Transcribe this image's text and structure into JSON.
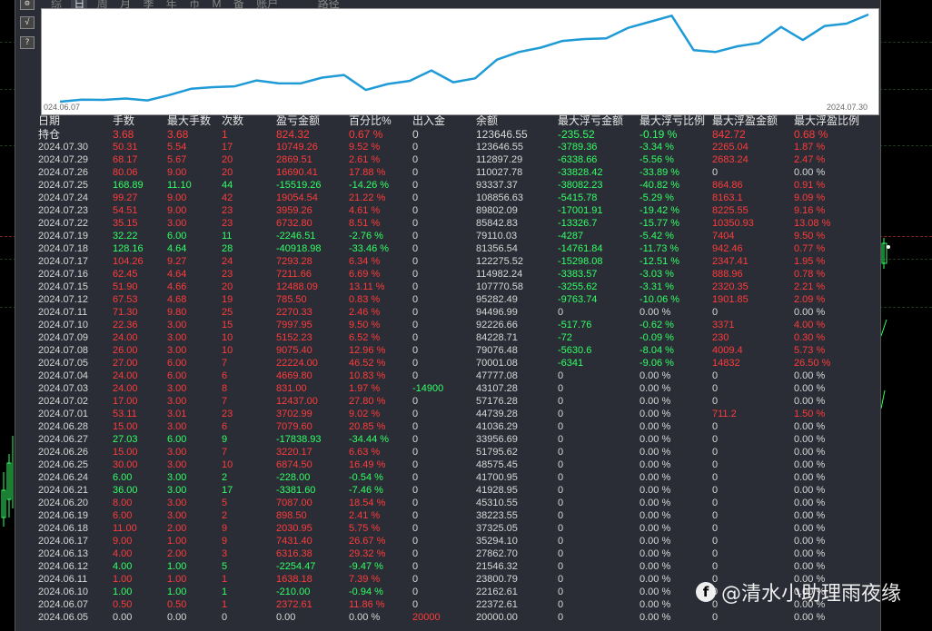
{
  "toolbar": {
    "icons": [
      "settings-icon",
      "check-icon",
      "help-icon"
    ],
    "icon_glyphs": [
      "⚙",
      "√",
      "?"
    ],
    "tabs": [
      "综",
      "日",
      "周",
      "月",
      "季",
      "年",
      "币",
      "M",
      "备",
      "账户"
    ],
    "active_tab": "日",
    "path_label": "路径"
  },
  "chart": {
    "start_label": "024.06.07",
    "end_label": "2024.07.30"
  },
  "chart_data": {
    "type": "line",
    "x": [
      "2024.06.05",
      "2024.06.07",
      "2024.06.10",
      "2024.06.11",
      "2024.06.12",
      "2024.06.13",
      "2024.06.17",
      "2024.06.18",
      "2024.06.19",
      "2024.06.20",
      "2024.06.21",
      "2024.06.24",
      "2024.06.25",
      "2024.06.26",
      "2024.06.27",
      "2024.06.28",
      "2024.07.01",
      "2024.07.02",
      "2024.07.03",
      "2024.07.04",
      "2024.07.05",
      "2024.07.08",
      "2024.07.09",
      "2024.07.10",
      "2024.07.11",
      "2024.07.12",
      "2024.07.15",
      "2024.07.16",
      "2024.07.17",
      "2024.07.18",
      "2024.07.19",
      "2024.07.22",
      "2024.07.23",
      "2024.07.24",
      "2024.07.25",
      "2024.07.26",
      "2024.07.29",
      "2024.07.30"
    ],
    "series": [
      {
        "values": [
          20000.0,
          22372.61,
          22162.61,
          23800.79,
          21546.32,
          27862.7,
          35294.1,
          37325.05,
          38223.55,
          45310.55,
          41928.95,
          41700.95,
          48575.45,
          51795.62,
          33956.69,
          41036.29,
          44739.28,
          57176.28,
          43107.28,
          47777.08,
          70001.08,
          79076.48,
          84228.71,
          92226.66,
          94496.99,
          95282.49,
          107770.58,
          114982.24,
          122275.52,
          81356.54,
          79110.03,
          85842.83,
          89802.09,
          108856.63,
          93337.37,
          110027.78,
          112897.29,
          123646.55
        ]
      }
    ]
  },
  "table": {
    "headers": [
      "日期",
      "手数",
      "最大手数",
      "次数",
      "盈亏金额",
      "百分比%",
      "出入金",
      "余额",
      "最大浮亏金额",
      "最大浮亏比例",
      "最大浮盈金额",
      "最大浮盈比例"
    ],
    "hold": [
      "持仓",
      "3.68",
      "3.68",
      "1",
      "824.32",
      "0.67 %",
      "0",
      "123646.55",
      "-235.52",
      "-0.19 %",
      "842.72",
      "0.68 %"
    ],
    "rows": [
      [
        "2024.07.30",
        "50.31",
        "5.54",
        "17",
        "10749.26",
        "9.52 %",
        "0",
        "123646.55",
        "-3789.36",
        "-3.34 %",
        "2265.04",
        "1.87 %"
      ],
      [
        "2024.07.29",
        "68.17",
        "5.67",
        "20",
        "2869.51",
        "2.61 %",
        "0",
        "112897.29",
        "-6338.66",
        "-5.56 %",
        "2683.24",
        "2.47 %"
      ],
      [
        "2024.07.26",
        "80.06",
        "9.00",
        "20",
        "16690.41",
        "17.88 %",
        "0",
        "110027.78",
        "-33828.42",
        "-33.89 %",
        "0",
        "0.00 %"
      ],
      [
        "2024.07.25",
        "168.89",
        "11.10",
        "44",
        "-15519.26",
        "-14.26 %",
        "0",
        "93337.37",
        "-38082.23",
        "-40.82 %",
        "864.86",
        "0.91 %"
      ],
      [
        "2024.07.24",
        "99.27",
        "9.00",
        "42",
        "19054.54",
        "21.22 %",
        "0",
        "108856.63",
        "-5415.78",
        "-5.29 %",
        "8163.1",
        "9.09 %"
      ],
      [
        "2024.07.23",
        "54.51",
        "9.00",
        "23",
        "3959.26",
        "4.61 %",
        "0",
        "89802.09",
        "-17001.91",
        "-19.42 %",
        "8225.55",
        "9.16 %"
      ],
      [
        "2024.07.22",
        "35.15",
        "3.00",
        "23",
        "6732.80",
        "8.51 %",
        "0",
        "85842.83",
        "-13326.7",
        "-15.77 %",
        "10350.93",
        "13.08 %"
      ],
      [
        "2024.07.19",
        "32.22",
        "6.00",
        "11",
        "-2246.51",
        "-2.76 %",
        "0",
        "79110.03",
        "-4287",
        "-5.42 %",
        "7404",
        "9.50 %"
      ],
      [
        "2024.07.18",
        "128.16",
        "4.64",
        "28",
        "-40918.98",
        "-33.46 %",
        "0",
        "81356.54",
        "-14761.84",
        "-11.73 %",
        "942.46",
        "0.77 %"
      ],
      [
        "2024.07.17",
        "104.26",
        "9.27",
        "24",
        "7293.28",
        "6.34 %",
        "0",
        "122275.52",
        "-15298.08",
        "-12.51 %",
        "2347.41",
        "1.95 %"
      ],
      [
        "2024.07.16",
        "62.45",
        "4.64",
        "23",
        "7211.66",
        "6.69 %",
        "0",
        "114982.24",
        "-3383.57",
        "-3.03 %",
        "888.96",
        "0.78 %"
      ],
      [
        "2024.07.15",
        "51.90",
        "4.66",
        "20",
        "12488.09",
        "13.11 %",
        "0",
        "107770.58",
        "-3255.62",
        "-3.31 %",
        "2320.35",
        "2.21 %"
      ],
      [
        "2024.07.12",
        "67.53",
        "4.68",
        "19",
        "785.50",
        "0.83 %",
        "0",
        "95282.49",
        "-9763.74",
        "-10.06 %",
        "1901.85",
        "2.09 %"
      ],
      [
        "2024.07.11",
        "71.30",
        "9.80",
        "25",
        "2270.33",
        "2.46 %",
        "0",
        "94496.99",
        "0",
        "0.00 %",
        "0",
        "0.00 %"
      ],
      [
        "2024.07.10",
        "22.36",
        "3.00",
        "15",
        "7997.95",
        "9.50 %",
        "0",
        "92226.66",
        "-517.76",
        "-0.62 %",
        "3371",
        "4.00 %"
      ],
      [
        "2024.07.09",
        "24.00",
        "3.00",
        "10",
        "5152.23",
        "6.52 %",
        "0",
        "84228.71",
        "-72",
        "-0.09 %",
        "230",
        "0.30 %"
      ],
      [
        "2024.07.08",
        "26.00",
        "3.00",
        "10",
        "9075.40",
        "12.96 %",
        "0",
        "79076.48",
        "-5630.6",
        "-8.04 %",
        "4009.4",
        "5.73 %"
      ],
      [
        "2024.07.05",
        "27.00",
        "6.00",
        "7",
        "22224.00",
        "46.52 %",
        "0",
        "70001.08",
        "-6341",
        "-9.06 %",
        "14832",
        "26.50 %"
      ],
      [
        "2024.07.04",
        "24.00",
        "6.00",
        "6",
        "4669.80",
        "10.83 %",
        "0",
        "47777.08",
        "0",
        "0.00 %",
        "0",
        "0.00 %"
      ],
      [
        "2024.07.03",
        "24.00",
        "3.00",
        "8",
        "831.00",
        "1.97 %",
        "-14900",
        "43107.28",
        "0",
        "0.00 %",
        "0",
        "0.00 %"
      ],
      [
        "2024.07.02",
        "17.00",
        "3.00",
        "7",
        "12437.00",
        "27.80 %",
        "0",
        "57176.28",
        "0",
        "0.00 %",
        "0",
        "0.00 %"
      ],
      [
        "2024.07.01",
        "53.11",
        "3.01",
        "23",
        "3702.99",
        "9.02 %",
        "0",
        "44739.28",
        "0",
        "0.00 %",
        "711.2",
        "1.50 %"
      ],
      [
        "2024.06.28",
        "15.00",
        "3.00",
        "6",
        "7079.60",
        "20.85 %",
        "0",
        "41036.29",
        "0",
        "0.00 %",
        "0",
        "0.00 %"
      ],
      [
        "2024.06.27",
        "27.03",
        "6.00",
        "9",
        "-17838.93",
        "-34.44 %",
        "0",
        "33956.69",
        "0",
        "0.00 %",
        "0",
        "0.00 %"
      ],
      [
        "2024.06.26",
        "15.00",
        "3.00",
        "7",
        "3220.17",
        "6.63 %",
        "0",
        "51795.62",
        "0",
        "0.00 %",
        "0",
        "0.00 %"
      ],
      [
        "2024.06.25",
        "30.00",
        "3.00",
        "10",
        "6874.50",
        "16.49 %",
        "0",
        "48575.45",
        "0",
        "0.00 %",
        "0",
        "0.00 %"
      ],
      [
        "2024.06.24",
        "6.00",
        "3.00",
        "2",
        "-228.00",
        "-0.54 %",
        "0",
        "41700.95",
        "0",
        "0.00 %",
        "0",
        "0.00 %"
      ],
      [
        "2024.06.21",
        "36.00",
        "3.00",
        "17",
        "-3381.60",
        "-7.46 %",
        "0",
        "41928.95",
        "0",
        "0.00 %",
        "0",
        "0.00 %"
      ],
      [
        "2024.06.20",
        "8.00",
        "3.00",
        "5",
        "7087.00",
        "18.54 %",
        "0",
        "45310.55",
        "0",
        "0.00 %",
        "0",
        "0.00 %"
      ],
      [
        "2024.06.19",
        "6.00",
        "3.00",
        "2",
        "898.50",
        "2.41 %",
        "0",
        "38223.55",
        "0",
        "0.00 %",
        "0",
        "0.00 %"
      ],
      [
        "2024.06.18",
        "11.00",
        "2.00",
        "9",
        "2030.95",
        "5.75 %",
        "0",
        "37325.05",
        "0",
        "0.00 %",
        "0",
        "0.00 %"
      ],
      [
        "2024.06.17",
        "9.00",
        "1.00",
        "9",
        "7431.40",
        "26.67 %",
        "0",
        "35294.10",
        "0",
        "0.00 %",
        "0",
        "0.00 %"
      ],
      [
        "2024.06.13",
        "4.00",
        "2.00",
        "3",
        "6316.38",
        "29.32 %",
        "0",
        "27862.70",
        "0",
        "0.00 %",
        "0",
        "0.00 %"
      ],
      [
        "2024.06.12",
        "4.00",
        "1.00",
        "5",
        "-2254.47",
        "-9.47 %",
        "0",
        "21546.32",
        "0",
        "0.00 %",
        "0",
        "0.00 %"
      ],
      [
        "2024.06.11",
        "1.00",
        "1.00",
        "1",
        "1638.18",
        "7.39 %",
        "0",
        "23800.79",
        "0",
        "0.00 %",
        "0",
        "0.00 %"
      ],
      [
        "2024.06.10",
        "1.00",
        "1.00",
        "1",
        "-210.00",
        "-0.94 %",
        "0",
        "22162.61",
        "0",
        "0.00 %",
        "0",
        "0.00 %"
      ],
      [
        "2024.06.07",
        "0.50",
        "0.50",
        "1",
        "2372.61",
        "11.86 %",
        "0",
        "22372.61",
        "0",
        "0.00 %",
        "0",
        "0.00 %"
      ],
      [
        "2024.06.05",
        "0.00",
        "0.00",
        "0",
        "0.00",
        "0.00 %",
        "20000",
        "20000.00",
        "0",
        "0.00 %",
        "0",
        "0.00 %"
      ]
    ]
  },
  "watermark": {
    "icon_glyph": "f",
    "text": "@清水小助理雨夜缘"
  },
  "colors": {
    "profit": "#ff3b3b",
    "loss": "#33ff66",
    "neutral": "#d8d8d8",
    "equity_line": "#1e9ad6",
    "chart_bg": "#ffffff",
    "dialog_bg": "#2a2d35"
  }
}
